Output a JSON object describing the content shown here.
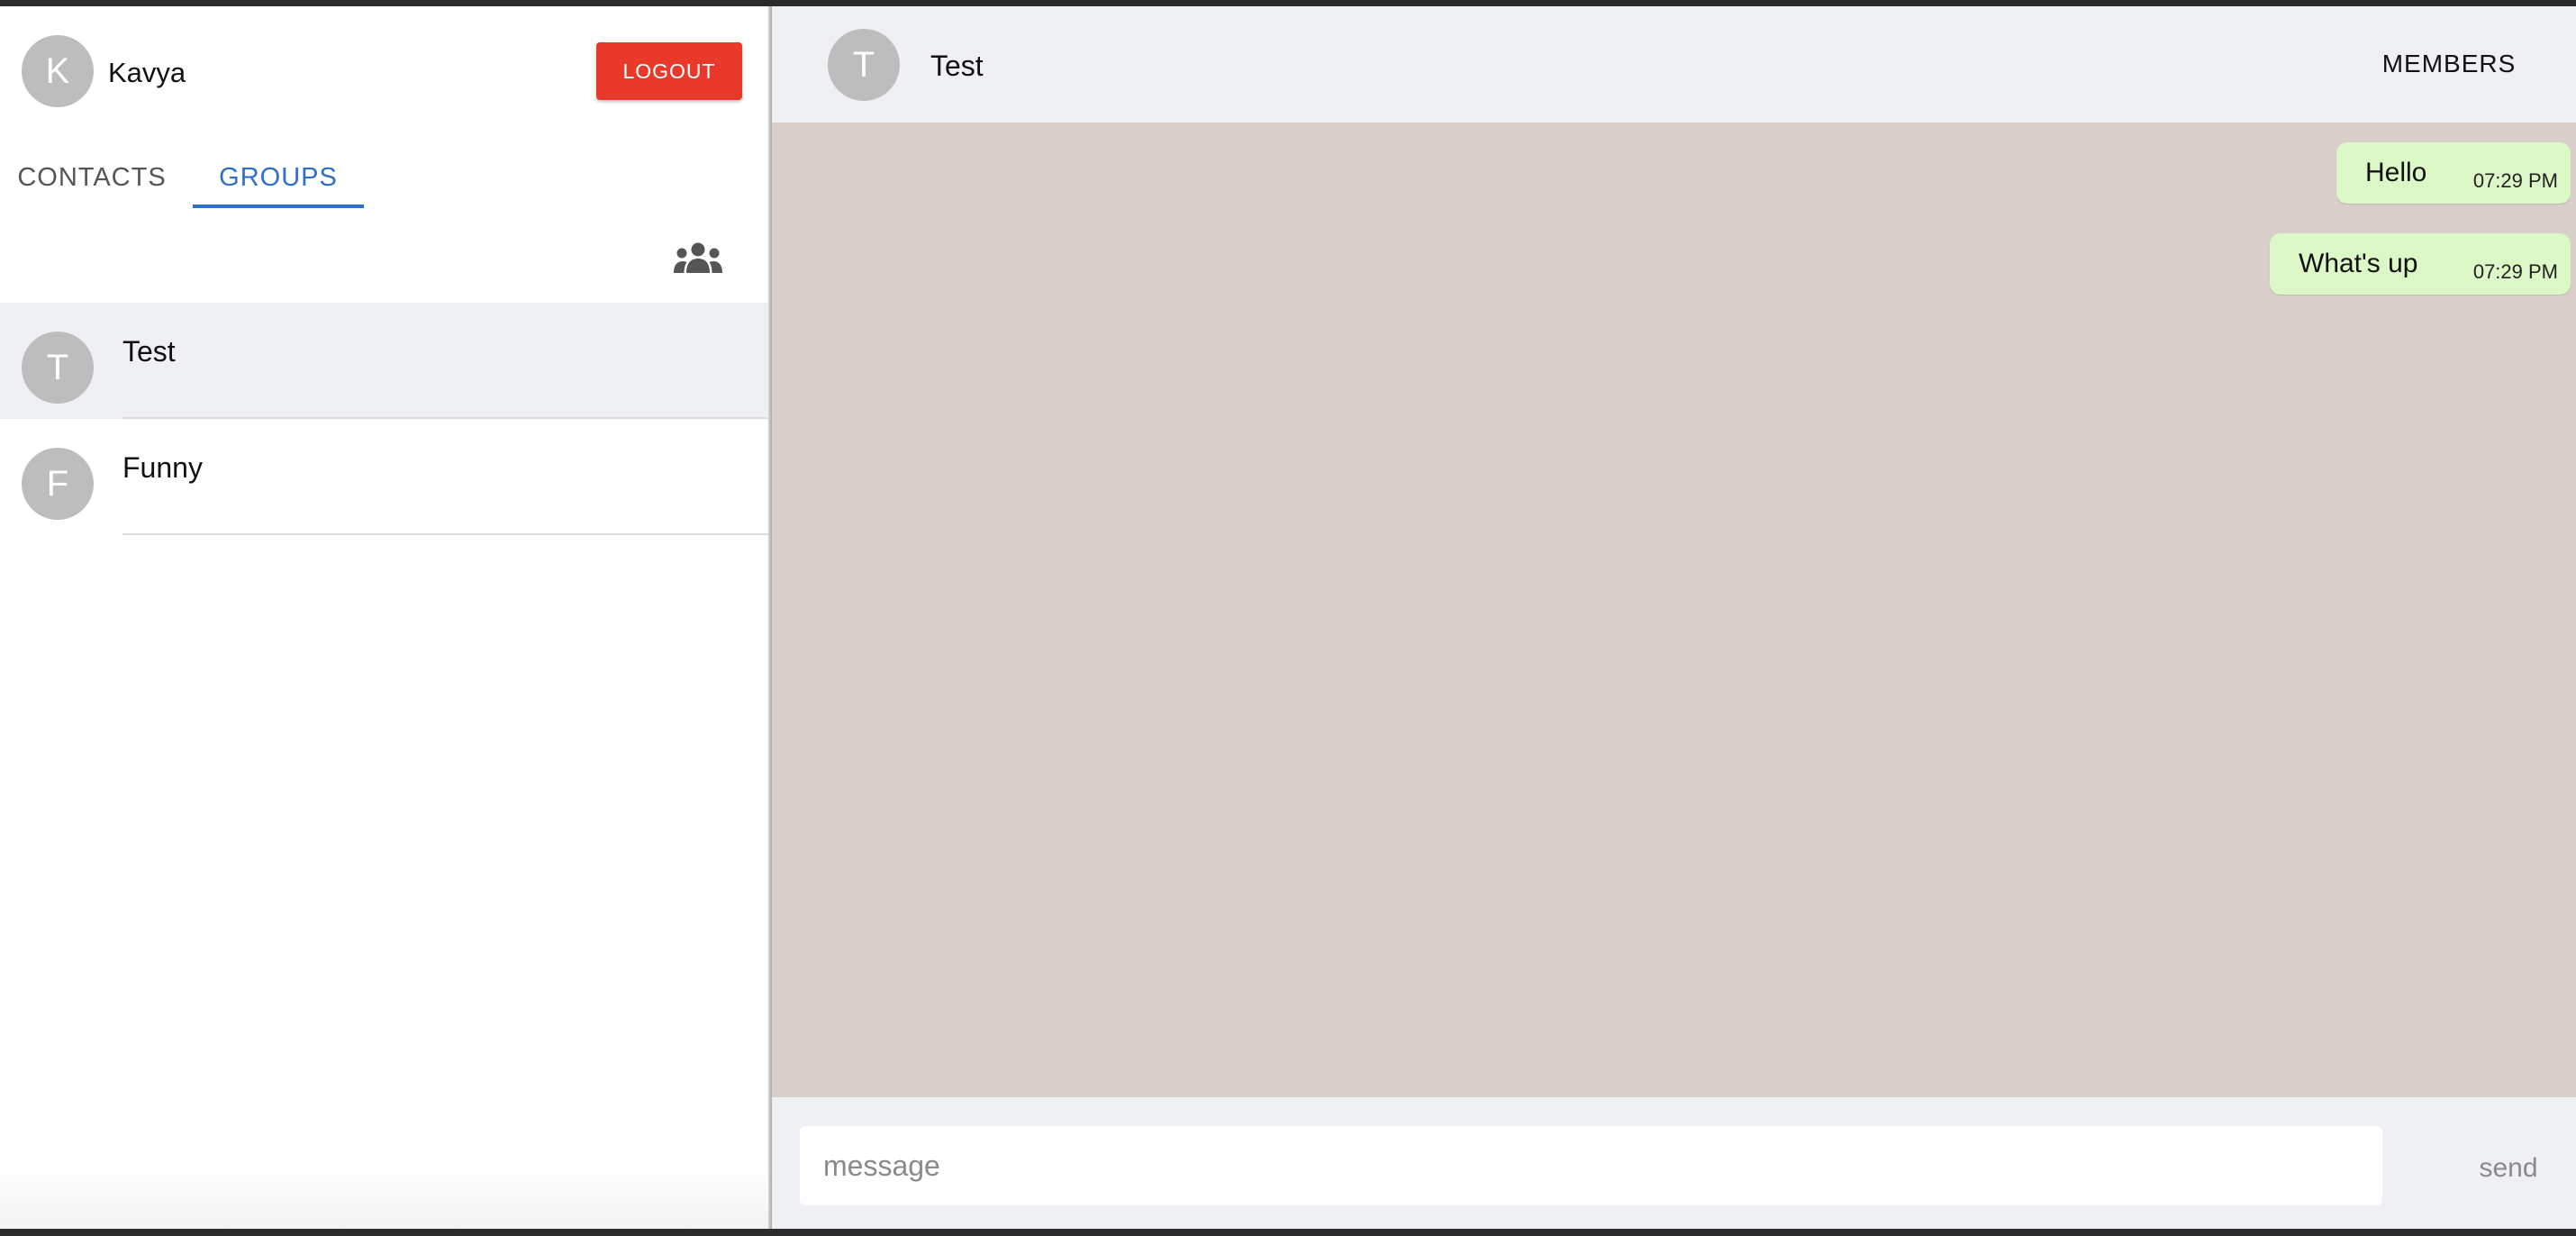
{
  "user": {
    "initial": "K",
    "name": "Kavya"
  },
  "actions": {
    "logout_label": "LOGOUT"
  },
  "tabs": [
    {
      "label": "CONTACTS",
      "active": false
    },
    {
      "label": "GROUPS",
      "active": true
    }
  ],
  "icons": {
    "new_group": "groups-icon"
  },
  "groups": [
    {
      "initial": "T",
      "name": "Test",
      "selected": true
    },
    {
      "initial": "F",
      "name": "Funny",
      "selected": false
    }
  ],
  "chat": {
    "initial": "T",
    "title": "Test",
    "members_label": "MEMBERS",
    "messages": [
      {
        "text": "Hello",
        "time": "07:29 PM"
      },
      {
        "text": "What's up",
        "time": "07:29 PM"
      }
    ]
  },
  "composer": {
    "placeholder": "message",
    "value": "",
    "send_label": "send"
  },
  "colors": {
    "accent": "#2e6fc7",
    "logout": "#e8392a",
    "chat_background": "#d8cfcb",
    "outgoing_bubble": "#dcf8c6",
    "header_background": "#eff0f4"
  }
}
